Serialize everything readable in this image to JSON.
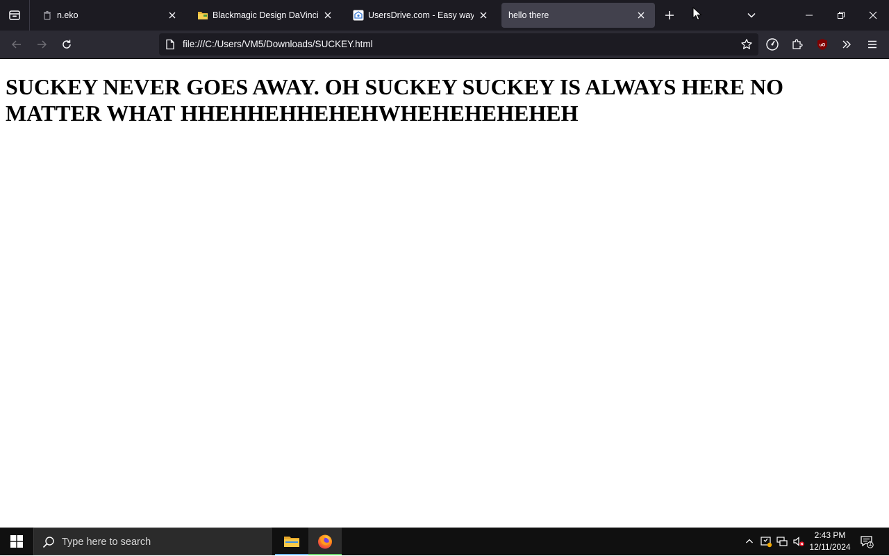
{
  "browser": {
    "tabs": [
      {
        "title": "n.eko",
        "favicon": "trash-icon",
        "active": false
      },
      {
        "title": "Blackmagic Design DaVinci Res",
        "favicon": "folder-icon",
        "active": false
      },
      {
        "title": "UsersDrive.com - Easy way to s",
        "favicon": "usersdrive-icon",
        "active": false
      },
      {
        "title": "hello there",
        "favicon": "",
        "active": true
      }
    ],
    "url": "file:///C:/Users/VM5/Downloads/SUCKEY.html"
  },
  "page": {
    "heading": "SUCKEY NEVER GOES AWAY. OH SUCKEY SUCKEY IS ALWAYS HERE NO MATTER WHAT HHEHHEHHEHEHWHEHEHEHEHEH"
  },
  "taskbar": {
    "search_placeholder": "Type here to search",
    "apps": [
      "file-explorer-icon",
      "firefox-icon"
    ],
    "clock": {
      "time": "2:43 PM",
      "date": "12/11/2024"
    },
    "notification_count": "1"
  },
  "colors": {
    "tabstrip_bg": "#1c1b22",
    "navbar_bg": "#2b2a33",
    "active_tab_bg": "#42414d",
    "taskbar_bg": "#101010",
    "firefox_accent": "#6ed46e"
  }
}
